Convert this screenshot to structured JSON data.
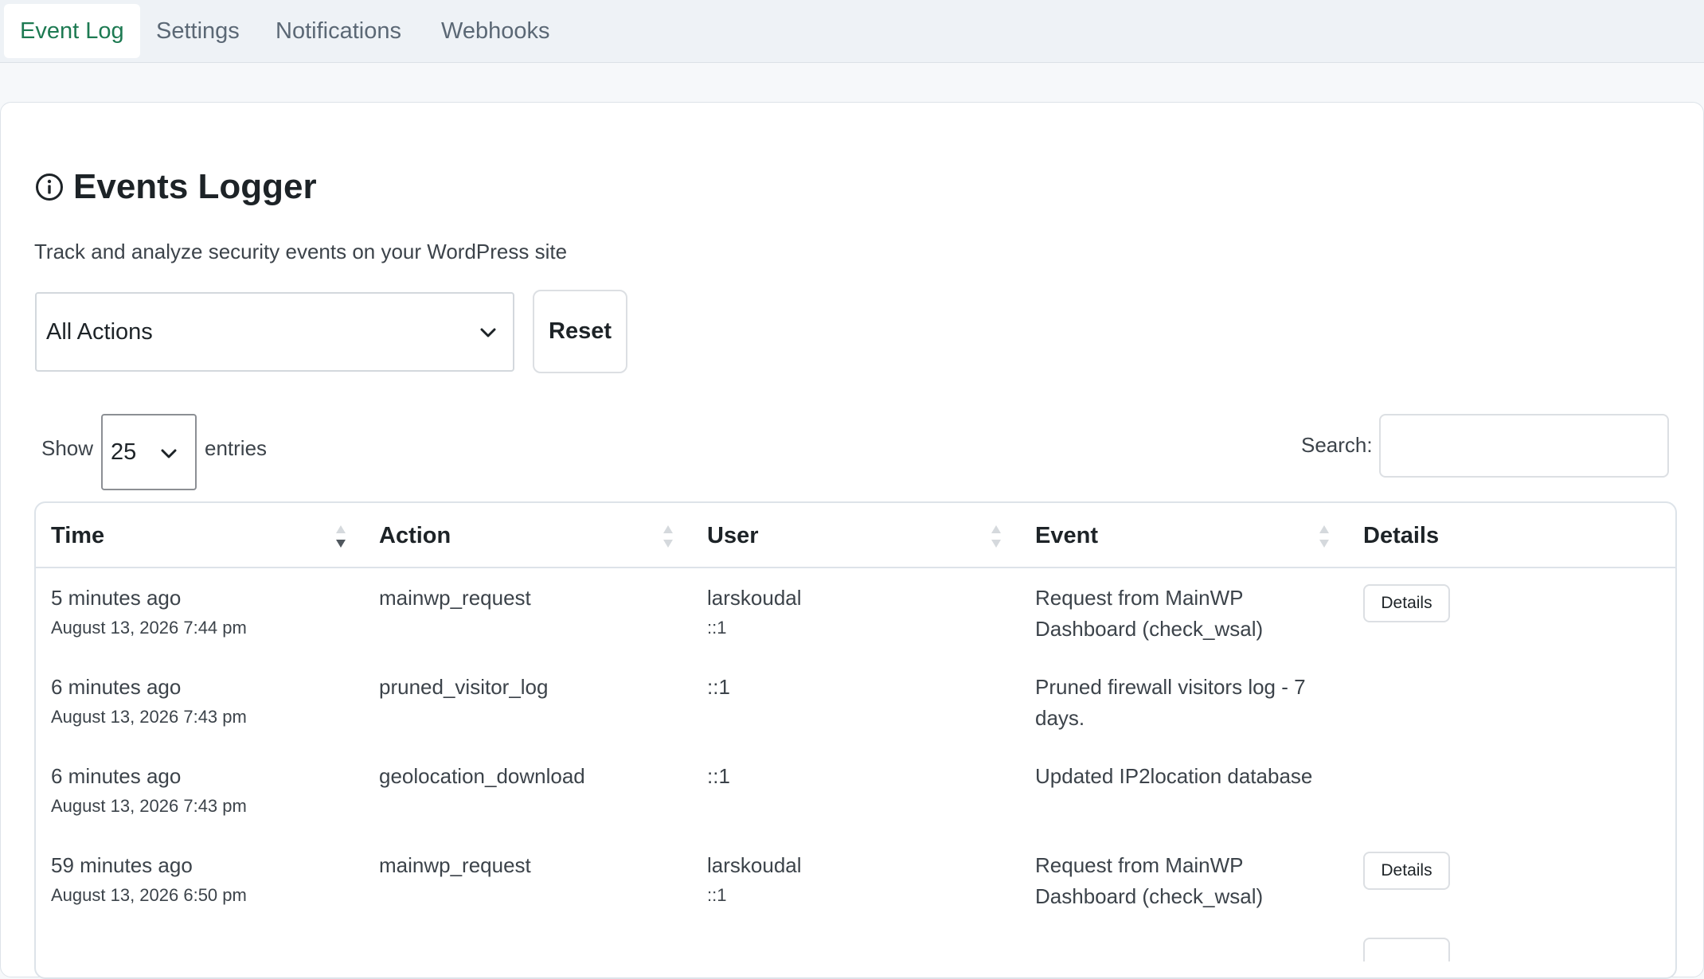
{
  "tabs": [
    {
      "label": "Event Log",
      "active": true
    },
    {
      "label": "Settings",
      "active": false
    },
    {
      "label": "Notifications",
      "active": false
    },
    {
      "label": "Webhooks",
      "active": false
    }
  ],
  "header": {
    "title": "Events Logger",
    "subtitle": "Track and analyze security events on your WordPress site",
    "icon": "info-circle-icon"
  },
  "filters": {
    "action_select_value": "All Actions",
    "reset_label": "Reset"
  },
  "length_menu": {
    "show_label": "Show",
    "entries_value": "25",
    "entries_label": "entries"
  },
  "search": {
    "label": "Search:",
    "value": ""
  },
  "table": {
    "columns": [
      {
        "label": "Time",
        "sortable": true,
        "sorted": "desc"
      },
      {
        "label": "Action",
        "sortable": true
      },
      {
        "label": "User",
        "sortable": true
      },
      {
        "label": "Event",
        "sortable": true
      },
      {
        "label": "Details",
        "sortable": false
      }
    ],
    "rows": [
      {
        "time_relative": "5 minutes ago",
        "time_absolute": "August 13, 2026 7:44 pm",
        "action": "mainwp_request",
        "user": "larskoudal",
        "ip": "::1",
        "event": "Request from MainWP Dashboard (check_wsal)",
        "details_label": "Details"
      },
      {
        "time_relative": "6 minutes ago",
        "time_absolute": "August 13, 2026 7:43 pm",
        "action": "pruned_visitor_log",
        "user": "::1",
        "ip": "",
        "event": "Pruned firewall visitors log - 7 days.",
        "details_label": ""
      },
      {
        "time_relative": "6 minutes ago",
        "time_absolute": "August 13, 2026 7:43 pm",
        "action": "geolocation_download",
        "user": "::1",
        "ip": "",
        "event": "Updated IP2location database",
        "details_label": ""
      },
      {
        "time_relative": "59 minutes ago",
        "time_absolute": "August 13, 2026 6:50 pm",
        "action": "mainwp_request",
        "user": "larskoudal",
        "ip": "::1",
        "event": "Request from MainWP Dashboard (check_wsal)",
        "details_label": "Details"
      }
    ]
  },
  "colors": {
    "accent": "#1d7a52",
    "tab_inactive": "#5b6875",
    "text": "#1d2327",
    "muted_text": "#3c434a",
    "border": "#dde3e9"
  }
}
